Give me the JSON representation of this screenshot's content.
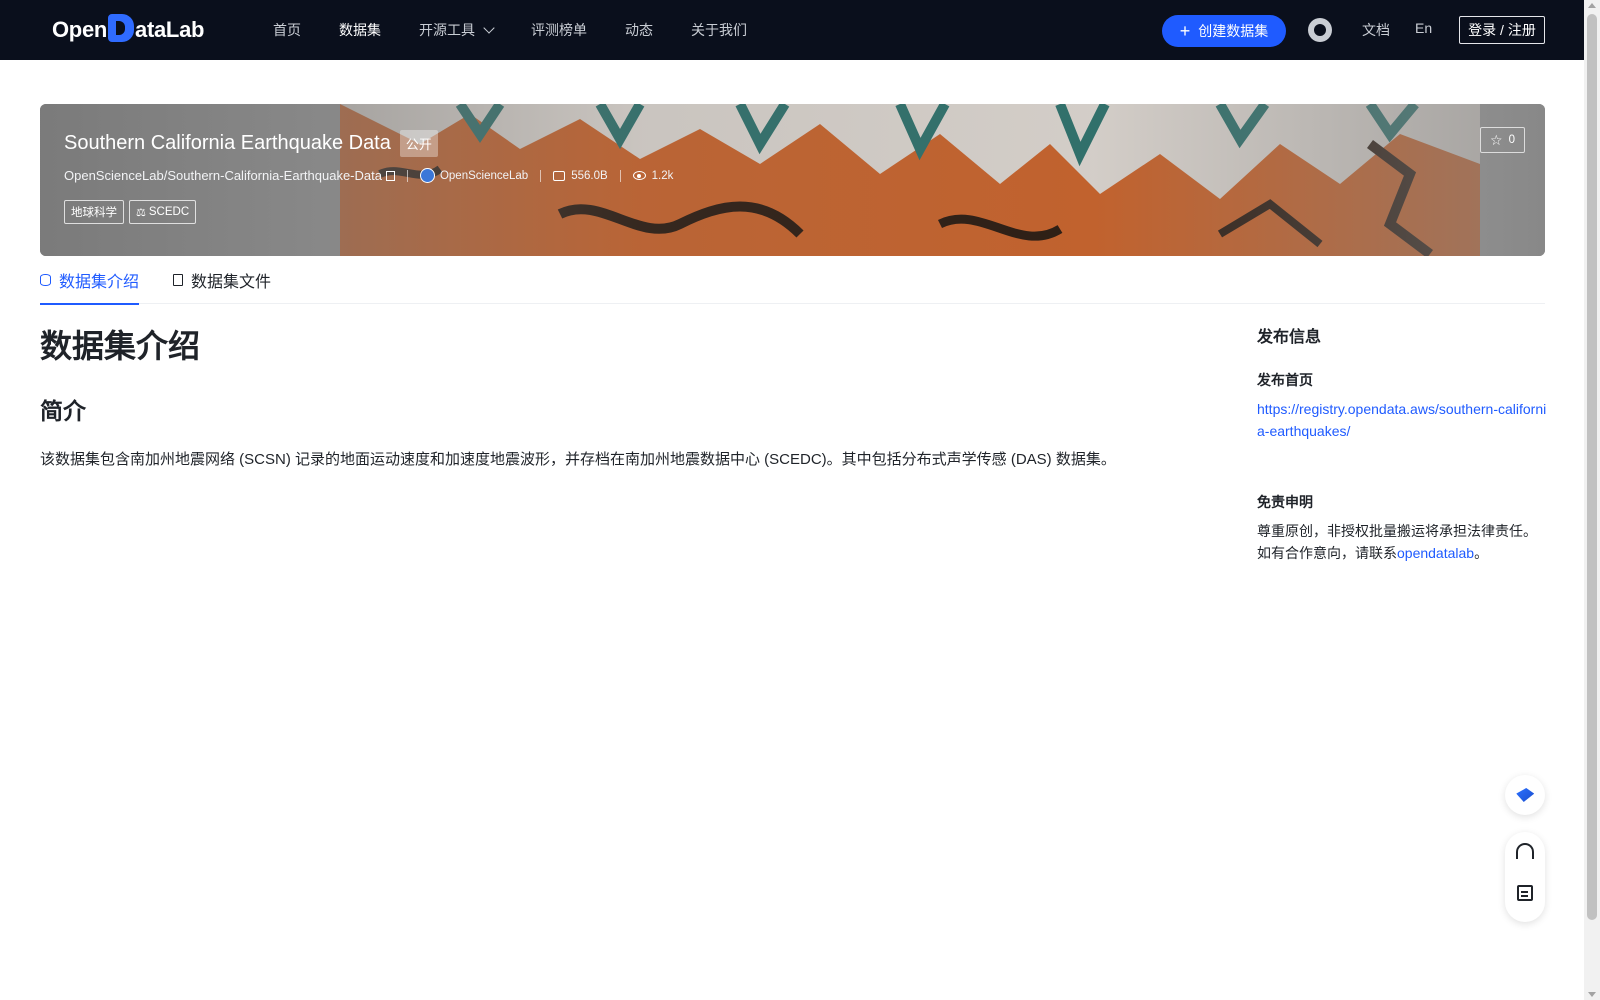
{
  "nav": {
    "logo_pre": "Open",
    "logo_post": "ataLab",
    "links": [
      "首页",
      "数据集",
      "开源工具",
      "评测榜单",
      "动态",
      "关于我们"
    ],
    "create": "创建数据集",
    "docs": "文档",
    "lang": "En",
    "login": "登录 / 注册"
  },
  "dataset": {
    "title": "Southern California Earthquake Data",
    "visibility": "公开",
    "repo_path": "OpenScienceLab/Southern-California-Earthquake-Data",
    "org": "OpenScienceLab",
    "size": "556.0B",
    "views": "1.2k",
    "tags": [
      "地球科学",
      "SCEDC"
    ],
    "stars": "0"
  },
  "tabs": [
    "数据集介绍",
    "数据集文件"
  ],
  "content": {
    "h1": "数据集介绍",
    "h2": "简介",
    "paragraph": "该数据集包含南加州地震网络 (SCSN) 记录的地面运动速度和加速度地震波形，并存档在南加州地震数据中心 (SCEDC)。其中包括分布式声学传感 (DAS) 数据集。"
  },
  "sidebar": {
    "heading": "发布信息",
    "homepage_label": "发布首页",
    "homepage_url": "https://registry.opendata.aws/southern-california-earthquakes/",
    "disclaimer_label": "免责申明",
    "disclaimer_line1": "尊重原创，非授权批量搬运将承担法律责任。",
    "disclaimer_line2_pre": "如有合作意向，请联系",
    "disclaimer_link": "opendatalab",
    "disclaimer_line2_post": "。"
  },
  "colors": {
    "nav_bg": "#0a0f1c",
    "accent": "#1f5bff"
  },
  "icons": [
    "github-icon",
    "plus-icon",
    "chevron-down-icon",
    "copy-icon",
    "org-avatar-icon",
    "disk-icon",
    "eye-icon",
    "scale-icon",
    "star-icon",
    "database-icon",
    "file-icon",
    "gem-icon",
    "headset-icon",
    "feedback-icon"
  ]
}
